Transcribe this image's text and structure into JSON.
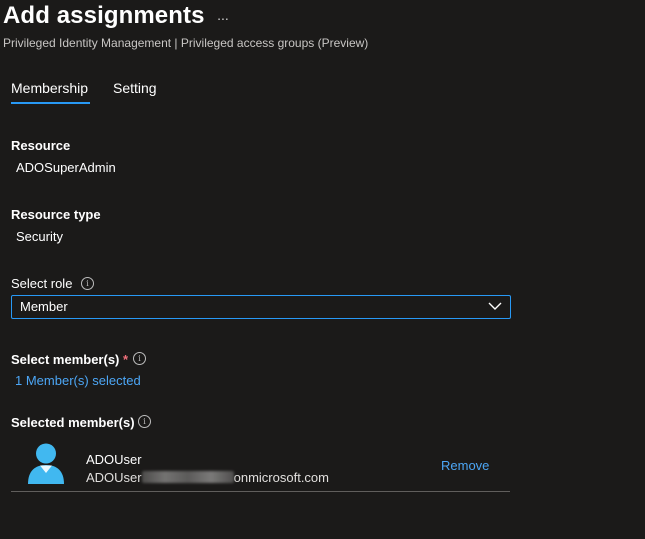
{
  "header": {
    "title": "Add assignments",
    "more_label": "...",
    "breadcrumb": "Privileged Identity Management | Privileged access groups (Preview)"
  },
  "tabs": [
    {
      "label": "Membership",
      "active": true
    },
    {
      "label": "Setting",
      "active": false
    }
  ],
  "resource": {
    "label": "Resource",
    "value": "ADOSuperAdmin"
  },
  "resource_type": {
    "label": "Resource type",
    "value": "Security"
  },
  "select_role": {
    "label": "Select role",
    "info_icon": "i",
    "selected_value": "Member"
  },
  "select_members": {
    "label": "Select member(s)",
    "required_marker": "*",
    "info_icon": "i",
    "link_text": "1 Member(s) selected"
  },
  "selected_members": {
    "label": "Selected member(s)",
    "info_icon": "i",
    "items": [
      {
        "name": "ADOUser",
        "upn_prefix": "ADOUser",
        "upn_suffix": "onmicrosoft.com",
        "remove_label": "Remove"
      }
    ]
  },
  "colors": {
    "background": "#1b1a19",
    "accent": "#2899f5",
    "link": "#4ca6f5",
    "required": "#f1707b",
    "avatar": "#41b8f0"
  },
  "icons": {
    "more": "ellipsis-icon",
    "info": "info-icon",
    "chevron": "chevron-down-icon",
    "avatar": "user-avatar-icon"
  }
}
